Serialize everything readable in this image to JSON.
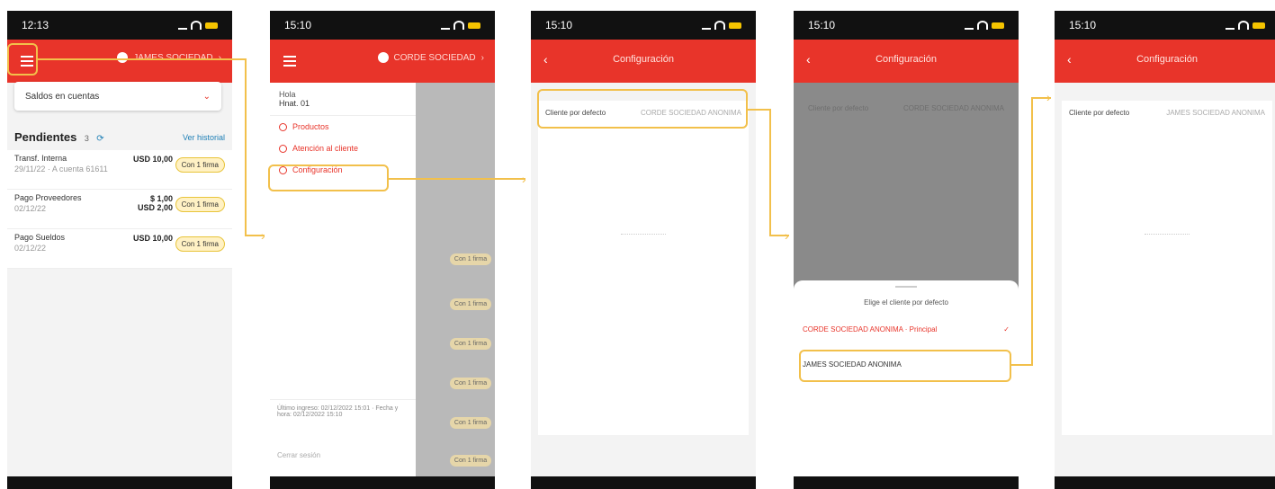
{
  "phone1": {
    "time": "12:13",
    "company": "JAMES SOCIEDAD",
    "account_select": "Saldos en cuentas",
    "pending_title": "Pendientes",
    "pending_count": "3",
    "history_link": "Ver historial",
    "rows": [
      {
        "name": "Transf. Interna",
        "detail": "29/11/22 · A cuenta 61611",
        "amount": "USD 10,00",
        "amount2": "",
        "badge": "Con 1 firma"
      },
      {
        "name": "Pago Proveedores",
        "detail": "02/12/22",
        "amount": "$ 1,00",
        "amount2": "USD 2,00",
        "badge": "Con 1 firma"
      },
      {
        "name": "Pago Sueldos",
        "detail": "02/12/22",
        "amount": "USD 10,00",
        "amount2": "",
        "badge": "Con 1 firma"
      }
    ]
  },
  "phone2": {
    "time": "15:10",
    "company": "CORDE SOCIEDAD",
    "user_label": "Hola",
    "user_name": "Hnat. 01",
    "menu": [
      "Productos",
      "Atención al cliente",
      "Configuración"
    ],
    "footer": "Último ingreso: 02/12/2022 15:01 · Fecha y hora: 02/12/2022 15:10",
    "logout": "Cerrar sesión",
    "pills": [
      "Con 1 firma",
      "Con 1 firma",
      "Con 1 firma",
      "Con 1 firma",
      "Con 1 firma",
      "Con 1 firma"
    ]
  },
  "phone3": {
    "time": "15:10",
    "title": "Configuración",
    "row_label": "Cliente por defecto",
    "row_value": "CORDE SOCIEDAD ANONIMA"
  },
  "phone4": {
    "time": "15:10",
    "title": "Configuración",
    "row_label": "Cliente por defecto",
    "row_value": "CORDE SOCIEDAD ANONIMA",
    "sheet_title": "Elige el cliente por defecto",
    "option1": "CORDE SOCIEDAD ANONIMA · Principal",
    "option2": "JAMES SOCIEDAD ANONIMA"
  },
  "phone5": {
    "time": "15:10",
    "title": "Configuración",
    "row_label": "Cliente por defecto",
    "row_value": "JAMES SOCIEDAD ANONIMA"
  },
  "colors": {
    "brand_red": "#e8342a",
    "highlight": "#f2c04b",
    "link_blue": "#1e7fb6"
  }
}
